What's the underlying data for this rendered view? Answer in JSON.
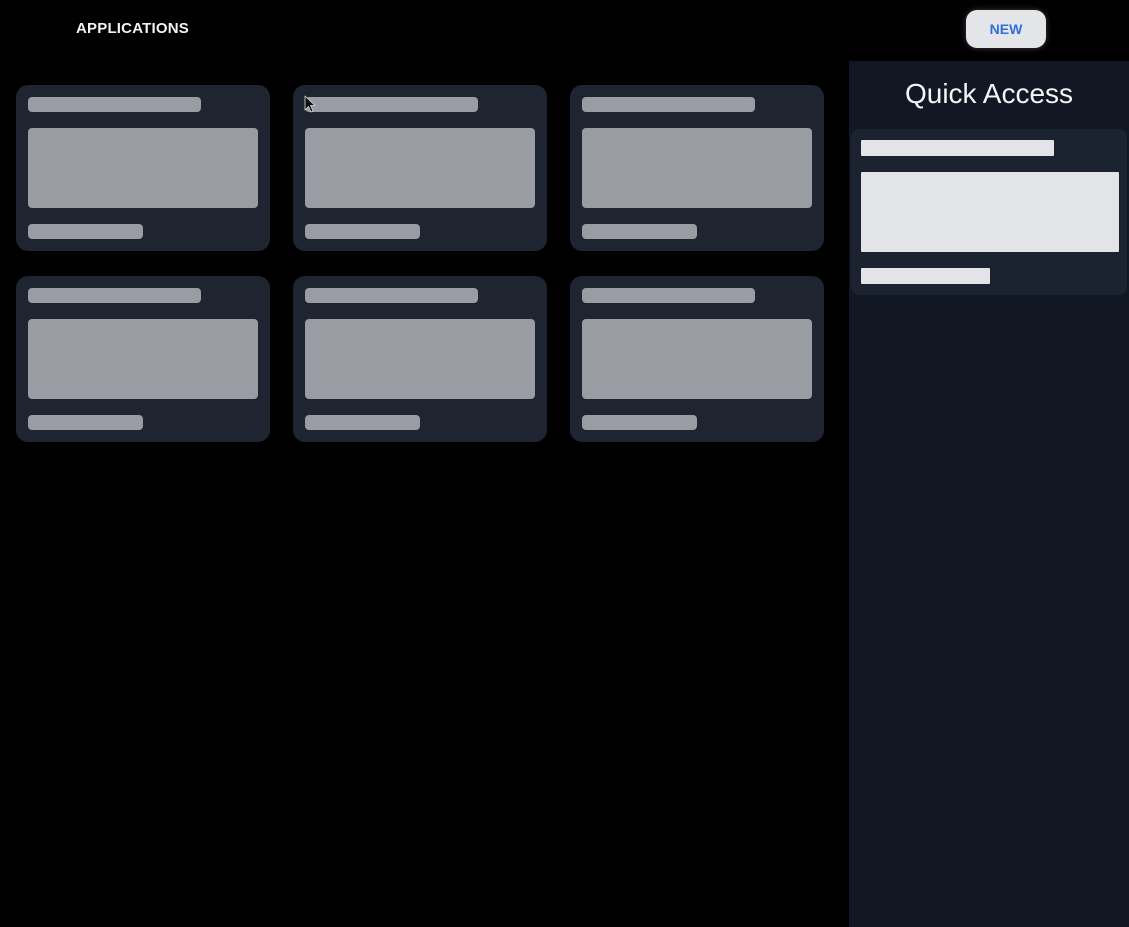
{
  "header": {
    "title": "APPLICATIONS",
    "new_button_label": "NEW"
  },
  "app_cards": {
    "count": 6,
    "state": "loading-skeleton"
  },
  "quick_access": {
    "title": "Quick Access",
    "items_count": 1,
    "state": "loading-skeleton"
  },
  "icons": {
    "cursor": "mouse-pointer-icon"
  },
  "colors": {
    "background": "#000000",
    "card": "#1e2530",
    "sidebar": "#111723",
    "skeleton": "#9a9ca3",
    "quick_skeleton": "#e3e4e8",
    "accent": "#2f6fd8"
  }
}
